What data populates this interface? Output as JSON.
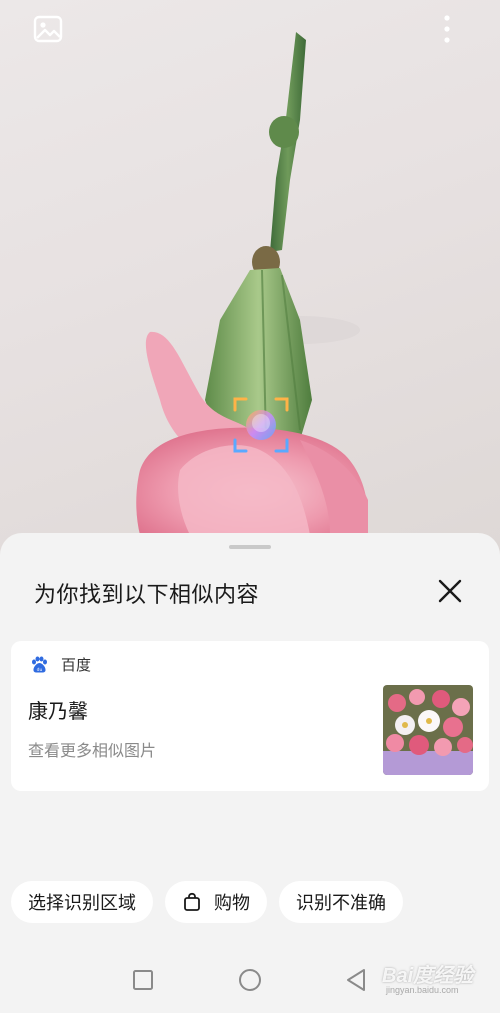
{
  "top_bar": {
    "gallery_icon": "image-gallery-icon",
    "more_icon": "more-vertical-icon"
  },
  "sheet": {
    "title": "为你找到以下相似内容",
    "close_icon": "close-icon"
  },
  "result": {
    "source_name": "百度",
    "source_icon": "baidu-paw-icon",
    "title": "康乃馨",
    "more_link": "查看更多相似图片"
  },
  "actions": {
    "select_region": "选择识别区域",
    "shopping": "购物",
    "shopping_icon": "shopping-bag-icon",
    "inaccurate": "识别不准确"
  },
  "nav": {
    "recents_icon": "square-recents-icon",
    "home_icon": "circle-home-icon",
    "back_icon": "triangle-back-icon"
  },
  "watermark": {
    "text": "Bai度经验",
    "sub": "jingyan.baidu.com"
  },
  "colors": {
    "accent_blue": "#2f6be0",
    "sheet_bg": "#f3f3f3",
    "card_bg": "#ffffff"
  }
}
